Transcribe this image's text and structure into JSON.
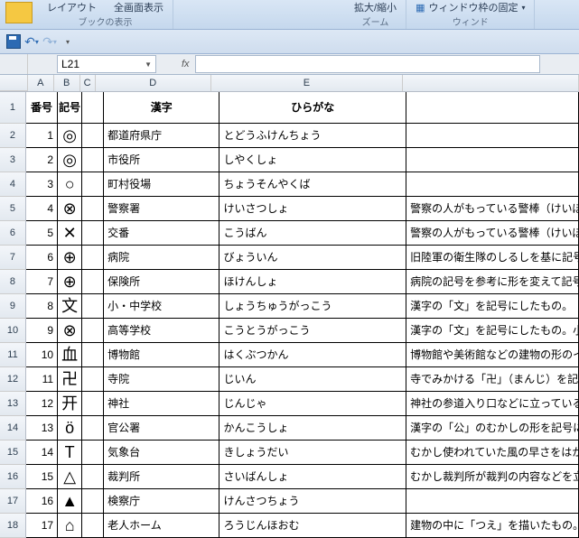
{
  "ribbon": {
    "layout": "レイアウト",
    "fullscreen": "全画面表示",
    "bookview": "ブックの表示",
    "zoominout": "拡大/縮小",
    "zoom": "ズーム",
    "freezepanes": "ウィンドウ枠の固定",
    "window": "ウィンド"
  },
  "namebox": "L21",
  "fx": "fx",
  "colhdrs": {
    "a": "A",
    "b": "B",
    "c": "C",
    "d": "D",
    "e": "E"
  },
  "headers": {
    "num": "番号",
    "sym": "記号",
    "kanji": "漢字",
    "hira": "ひらがな"
  },
  "rows": [
    {
      "n": "1",
      "s": "◎",
      "k": "都道府県庁",
      "h": "とどうふけんちょう",
      "d": ""
    },
    {
      "n": "2",
      "s": "◎",
      "k": "市役所",
      "h": "しやくしょ",
      "d": ""
    },
    {
      "n": "3",
      "s": "○",
      "k": "町村役場",
      "h": "ちょうそんやくば",
      "d": ""
    },
    {
      "n": "4",
      "s": "⊗",
      "k": "警察署",
      "h": "けいさつしょ",
      "d": "警察の人がもっている警棒（けいぼう）（も"
    },
    {
      "n": "5",
      "s": "✕",
      "k": "交番",
      "h": "こうばん",
      "d": "警察の人がもっている警棒（けいぼう）（も"
    },
    {
      "n": "6",
      "s": "⊕",
      "k": "病院",
      "h": "びょういん",
      "d": "旧陸軍の衛生隊のしるしを基に記号にし"
    },
    {
      "n": "7",
      "s": "⊕",
      "k": "保険所",
      "h": "ほけんしょ",
      "d": "病院の記号を参考に形を変えて記号にし"
    },
    {
      "n": "8",
      "s": "文",
      "k": "小・中学校",
      "h": "しょうちゅうがっこう",
      "d": "漢字の「文」を記号にしたもの。"
    },
    {
      "n": "9",
      "s": "⊗",
      "k": "高等学校",
      "h": "こうとうがっこう",
      "d": "漢字の「文」を記号にしたもの。小・中学校"
    },
    {
      "n": "10",
      "s": "血",
      "k": "博物館",
      "h": "はくぶつかん",
      "d": "博物館や美術館などの建物の形のイメー"
    },
    {
      "n": "11",
      "s": "卍",
      "k": "寺院",
      "h": "じいん",
      "d": "寺でみかける「卍」（まんじ）を記号にした"
    },
    {
      "n": "12",
      "s": "开",
      "k": "神社",
      "h": "じんじゃ",
      "d": "神社の参道入り口などに立っている鳥居"
    },
    {
      "n": "13",
      "s": "ö",
      "k": "官公署",
      "h": "かんこうしょ",
      "d": "漢字の「公」のむかしの形を記号にしたも"
    },
    {
      "n": "14",
      "s": "T",
      "k": "気象台",
      "h": "きしょうだい",
      "d": "むかし使われていた風の早さをはかる風"
    },
    {
      "n": "15",
      "s": "△",
      "k": "裁判所",
      "h": "さいばんしょ",
      "d": "むかし裁判所が裁判の内容などを立て札"
    },
    {
      "n": "16",
      "s": "▲",
      "k": "検察庁",
      "h": "けんさつちょう",
      "d": ""
    },
    {
      "n": "17",
      "s": "⌂",
      "k": "老人ホーム",
      "h": "ろうじんほおむ",
      "d": "建物の中に「つえ」を描いたもの。"
    }
  ],
  "rownums": [
    "1",
    "2",
    "3",
    "4",
    "5",
    "6",
    "7",
    "8",
    "9",
    "10",
    "11",
    "12",
    "13",
    "14",
    "15",
    "16",
    "17"
  ]
}
